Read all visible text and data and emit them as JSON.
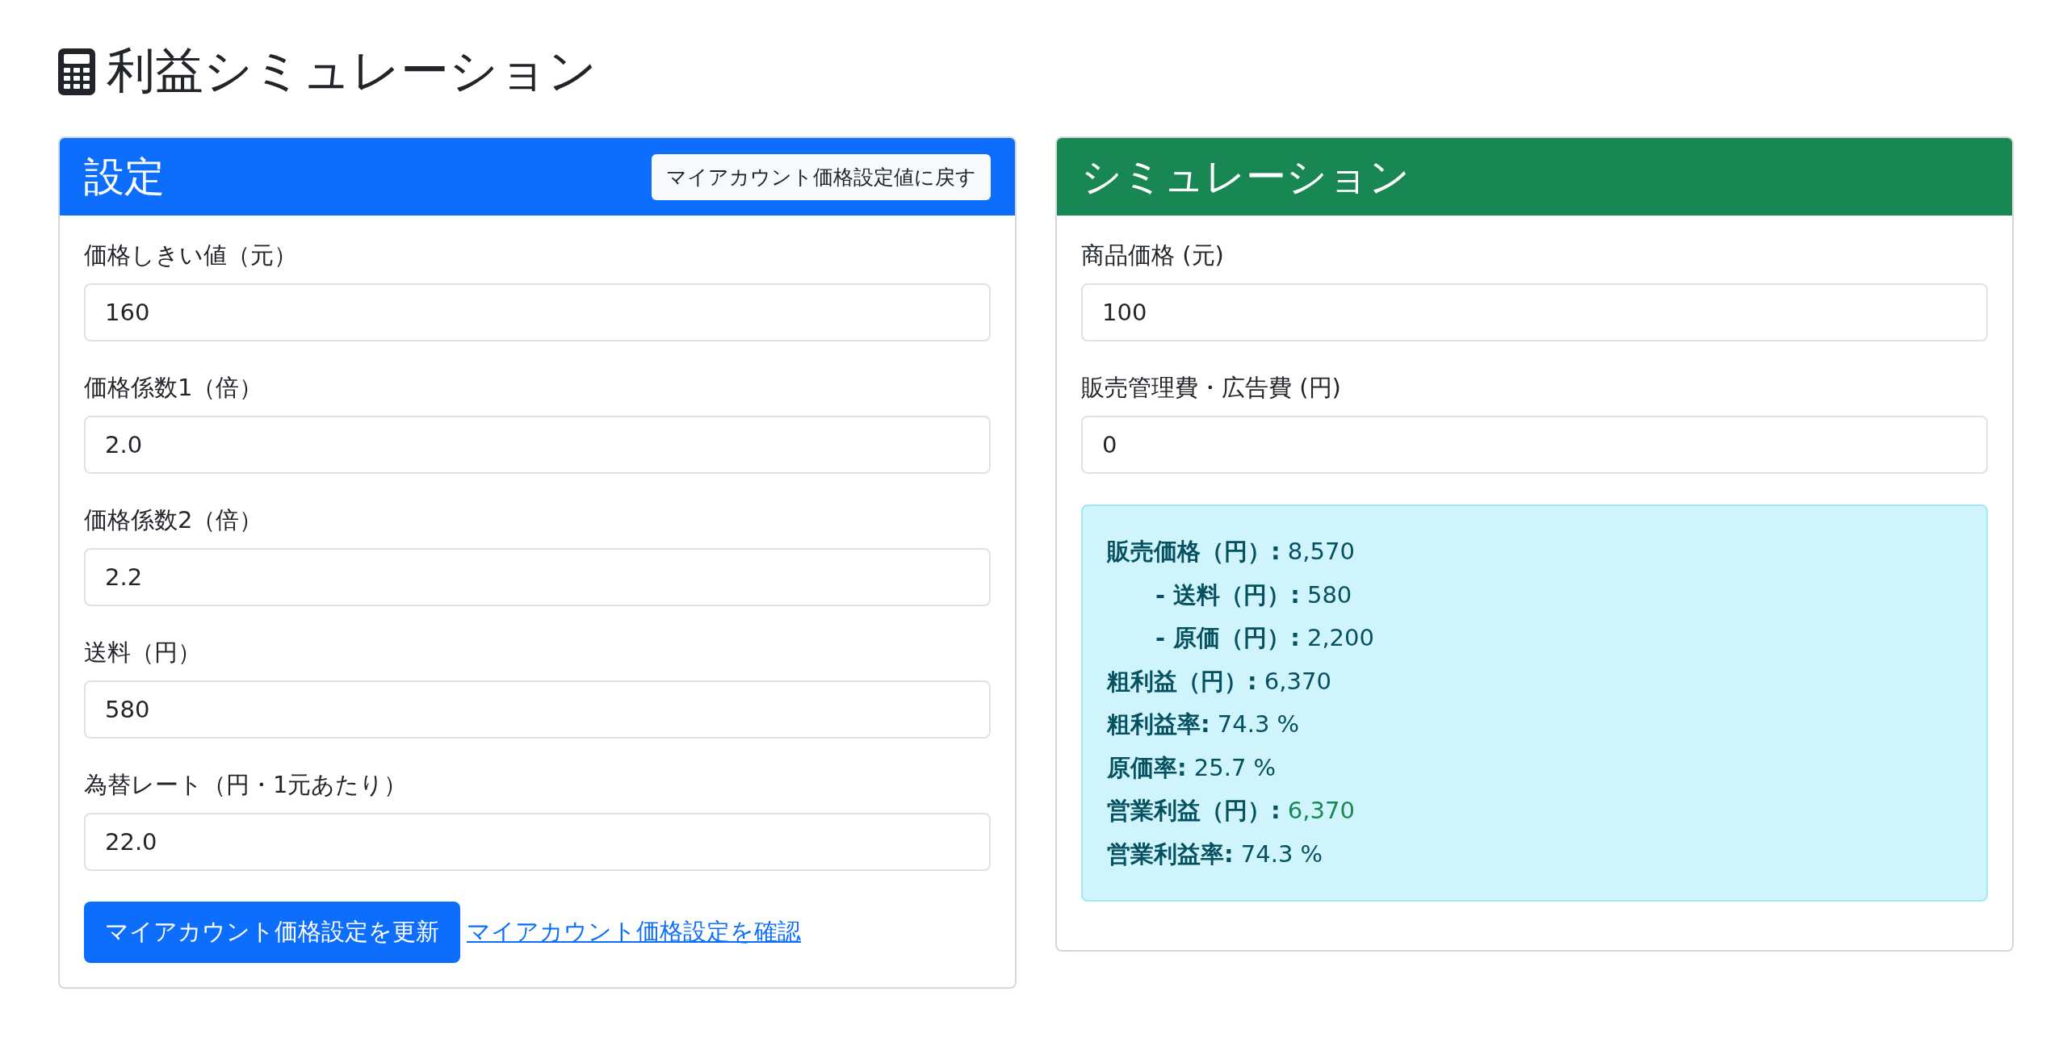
{
  "page_title": "利益シミュレーション",
  "settings": {
    "title": "設定",
    "reset_button": "マイアカウント価格設定値に戻す",
    "fields": [
      {
        "label": "価格しきい値（元）",
        "value": "160"
      },
      {
        "label": "価格係数1（倍）",
        "value": "2.0"
      },
      {
        "label": "価格係数2（倍）",
        "value": "2.2"
      },
      {
        "label": "送料（円）",
        "value": "580"
      },
      {
        "label": "為替レート（円・1元あたり）",
        "value": "22.0"
      }
    ],
    "update_button": "マイアカウント価格設定を更新",
    "check_link": "マイアカウント価格設定を確認"
  },
  "simulation": {
    "title": "シミュレーション",
    "fields": [
      {
        "label": "商品価格 (元)",
        "value": "100"
      },
      {
        "label": "販売管理費・広告費 (円)",
        "value": "0"
      }
    ],
    "results": [
      {
        "kind": "main",
        "label": "販売価格（円）:",
        "value": "8,570",
        "highlight": false
      },
      {
        "kind": "sub",
        "label": "- 送料（円）:",
        "value": "580",
        "highlight": false
      },
      {
        "kind": "sub",
        "label": "- 原価（円）:",
        "value": "2,200",
        "highlight": false
      },
      {
        "kind": "main",
        "label": "粗利益（円）:",
        "value": "6,370",
        "highlight": false
      },
      {
        "kind": "main",
        "label": "粗利益率:",
        "value": "74.3 %",
        "highlight": false
      },
      {
        "kind": "main",
        "label": "原価率:",
        "value": "25.7 %",
        "highlight": false
      },
      {
        "kind": "main",
        "label": "営業利益（円）:",
        "value": "6,370",
        "highlight": true
      },
      {
        "kind": "main",
        "label": "営業利益率:",
        "value": "74.3 %",
        "highlight": false
      }
    ]
  }
}
